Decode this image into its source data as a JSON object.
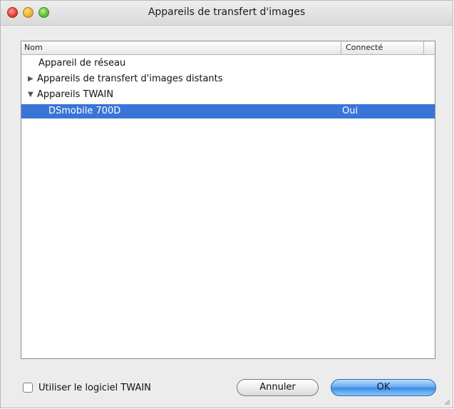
{
  "window": {
    "title": "Appareils de transfert d'images"
  },
  "table": {
    "columns": [
      "Nom",
      "Connecté"
    ],
    "rows": [
      {
        "label": "Appareil de réseau",
        "disclosure": "none",
        "connected": ""
      },
      {
        "label": "Appareils de transfert d'images distants",
        "disclosure": "collapsed",
        "connected": ""
      },
      {
        "label": "Appareils TWAIN",
        "disclosure": "expanded",
        "connected": ""
      },
      {
        "label": "DSmobile 700D",
        "disclosure": "none",
        "connected": "Oui",
        "selected": true
      }
    ],
    "selection_color": "#3875d7"
  },
  "footer": {
    "checkbox_label": "Utiliser le logiciel TWAIN",
    "checkbox_checked": false,
    "cancel_label": "Annuler",
    "ok_label": "OK"
  },
  "icons": {
    "collapsed": "disclosure-right-icon",
    "expanded": "disclosure-down-icon"
  }
}
